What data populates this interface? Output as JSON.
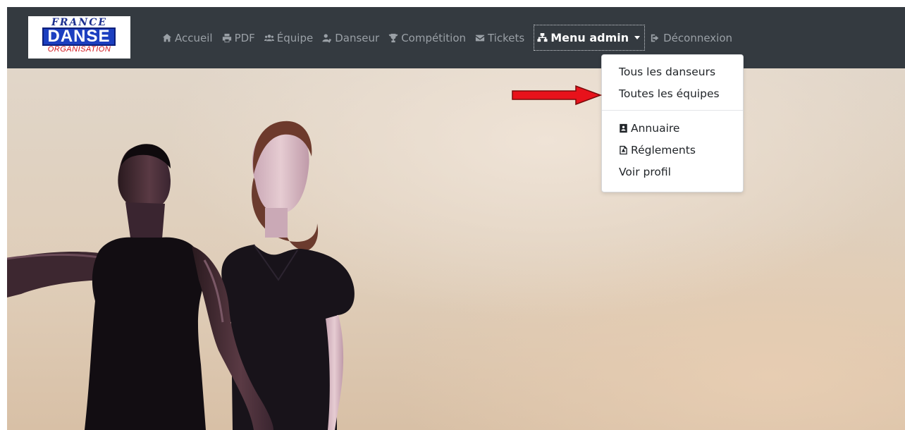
{
  "logo": {
    "top": "FRANCE",
    "mid": "DANSE",
    "bottom": "ORGANISATION"
  },
  "nav": {
    "home": "Accueil",
    "pdf": "PDF",
    "team": "Équipe",
    "dancer": "Danseur",
    "competition": "Compétition",
    "tickets": "Tickets",
    "admin": "Menu admin",
    "logout": "Déconnexion"
  },
  "dropdown": {
    "items": [
      "Tous les danseurs",
      "Toutes les équipes"
    ],
    "directory": "Annuaire",
    "rules": "Réglements",
    "profile": "Voir profil"
  },
  "colors": {
    "navbar": "#343a40",
    "nav_text": "#9aa0a6",
    "annotation_arrow": "#e8121b"
  }
}
